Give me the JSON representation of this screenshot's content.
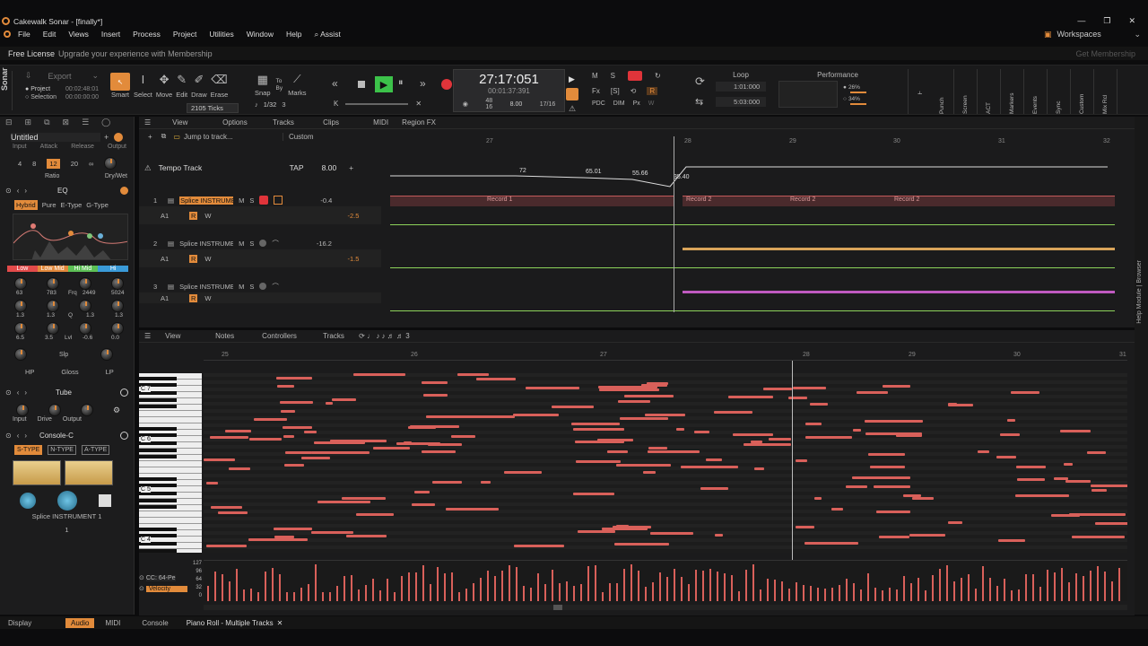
{
  "window": {
    "title": "Cakewalk Sonar - [finally*]"
  },
  "menu": [
    "File",
    "Edit",
    "Views",
    "Insert",
    "Process",
    "Project",
    "Utilities",
    "Window",
    "Help",
    "Assist"
  ],
  "workspaces_label": "Workspaces",
  "license": {
    "label": "Free License",
    "text": "Upgrade your experience with Membership",
    "button": "Get Membership"
  },
  "brand": "Sonar",
  "export": {
    "label": "Export",
    "project_label": "Project",
    "selection_label": "Selection",
    "project_time": "00:02:48:01",
    "selection_time": "00:00:00:00"
  },
  "tools": [
    "Smart",
    "Select",
    "Move",
    "Edit",
    "Draw",
    "Erase"
  ],
  "snap": {
    "label": "Snap",
    "ticks": "2105 Ticks",
    "to": "To",
    "by": "By",
    "marks": "Marks",
    "grid": "1/32",
    "grid_value": "3"
  },
  "transport": {
    "time": "27:17:051",
    "time_sub": "00:01:37:391",
    "meter_top": "48",
    "meter_bottom": "16",
    "tempo": "8.00",
    "signature": "17/16"
  },
  "mix_labels": {
    "m": "M",
    "s": "S",
    "fx": "Fx",
    "sb": "[S]",
    "pdc": "PDC",
    "dim": "DIM",
    "px": "Px",
    "w": "W",
    "r": "R"
  },
  "loop": {
    "label": "Loop",
    "start": "1:01:000",
    "end": "5:03:000"
  },
  "performance": {
    "label": "Performance",
    "cpu": "26%",
    "disk": "34%"
  },
  "right_toolbar": [
    "Punch",
    "Screen",
    "ACT",
    "Markers",
    "Events",
    "Sync",
    "Custom",
    "Mix Rcl"
  ],
  "prochannel": {
    "preset": "Untitled",
    "comp_labels": [
      "Input",
      "Attack",
      "Release",
      "Output"
    ],
    "ratio_values": [
      "4",
      "8",
      "12",
      "20",
      "∞"
    ],
    "ratio_label": "Ratio",
    "drywet": "Dry/Wet",
    "eq_label": "EQ",
    "eq_modes": [
      "Hybrid",
      "Pure",
      "E-Type",
      "G-Type"
    ],
    "bands": [
      "Low",
      "Low Mid",
      "Hi Mid",
      "Hi"
    ],
    "freq_values": [
      "63",
      "783",
      "2449",
      "5024"
    ],
    "freq_label": "Frq",
    "q_values": [
      "1.3",
      "1.3",
      "1.3",
      "1.3"
    ],
    "q_label": "Q",
    "lvl_values": [
      "6.5",
      "3.5",
      "-0.6",
      "0.0"
    ],
    "lvl_label": "Lvl",
    "slp_label": "Slp",
    "filters": [
      "HP",
      "Gloss",
      "LP"
    ],
    "tube_label": "Tube",
    "tube_knobs": [
      "Input",
      "Drive",
      "Output"
    ],
    "console_label": "Console-C",
    "console_modes": [
      "S-TYPE",
      "N-TYPE",
      "A-TYPE"
    ],
    "instrument": "Splice INSTRUMENT 1",
    "channel_num": "1"
  },
  "bottom_left": {
    "display": "Display",
    "audio": "Audio",
    "midi": "MIDI"
  },
  "track_view": {
    "menus": [
      "View",
      "Options",
      "Tracks",
      "Clips",
      "MIDI",
      "Region FX"
    ],
    "jump": "Jump to track...",
    "custom": "Custom",
    "ruler": [
      "27",
      "28",
      "29",
      "30",
      "31",
      "32"
    ],
    "tempo_track": "Tempo Track",
    "tap": "TAP",
    "tempo_value": "8.00",
    "tempo_points": [
      "72",
      "65.01",
      "55.66",
      "35.40"
    ],
    "tracks": [
      {
        "num": "1",
        "name": "Splice INSTRUMENT",
        "vol": "-0.4",
        "peak": "-2.5",
        "sub": "A1"
      },
      {
        "num": "2",
        "name": "Splice INSTRUMENT",
        "vol": "-16.2",
        "peak": "-1.5",
        "sub": "A1"
      },
      {
        "num": "3",
        "name": "Splice INSTRUMENT",
        "vol": "",
        "peak": "",
        "sub": "A1"
      }
    ],
    "clips": [
      "Record 1",
      "Record 2",
      "Record 2",
      "Record 2"
    ]
  },
  "pianoroll": {
    "menus": [
      "View",
      "Notes",
      "Controllers",
      "Tracks"
    ],
    "ruler": [
      "25",
      "26",
      "27",
      "28",
      "29",
      "30",
      "31"
    ],
    "octaves": [
      "C 7",
      "C 6",
      "C 5",
      "C 4"
    ],
    "cc_label": "CC: 64-Pe",
    "velocity_label": "Velocity",
    "vel_scale": [
      "127",
      "96",
      "64",
      "32",
      "0"
    ]
  },
  "bottom_tabs": [
    "Console",
    "Piano Roll - Multiple Tracks"
  ],
  "right_side_label": "Help Module | Browser",
  "colors": {
    "accent": "#e28b3b",
    "note": "#d9605a",
    "play": "#3cc24a",
    "record": "#e0343a"
  }
}
